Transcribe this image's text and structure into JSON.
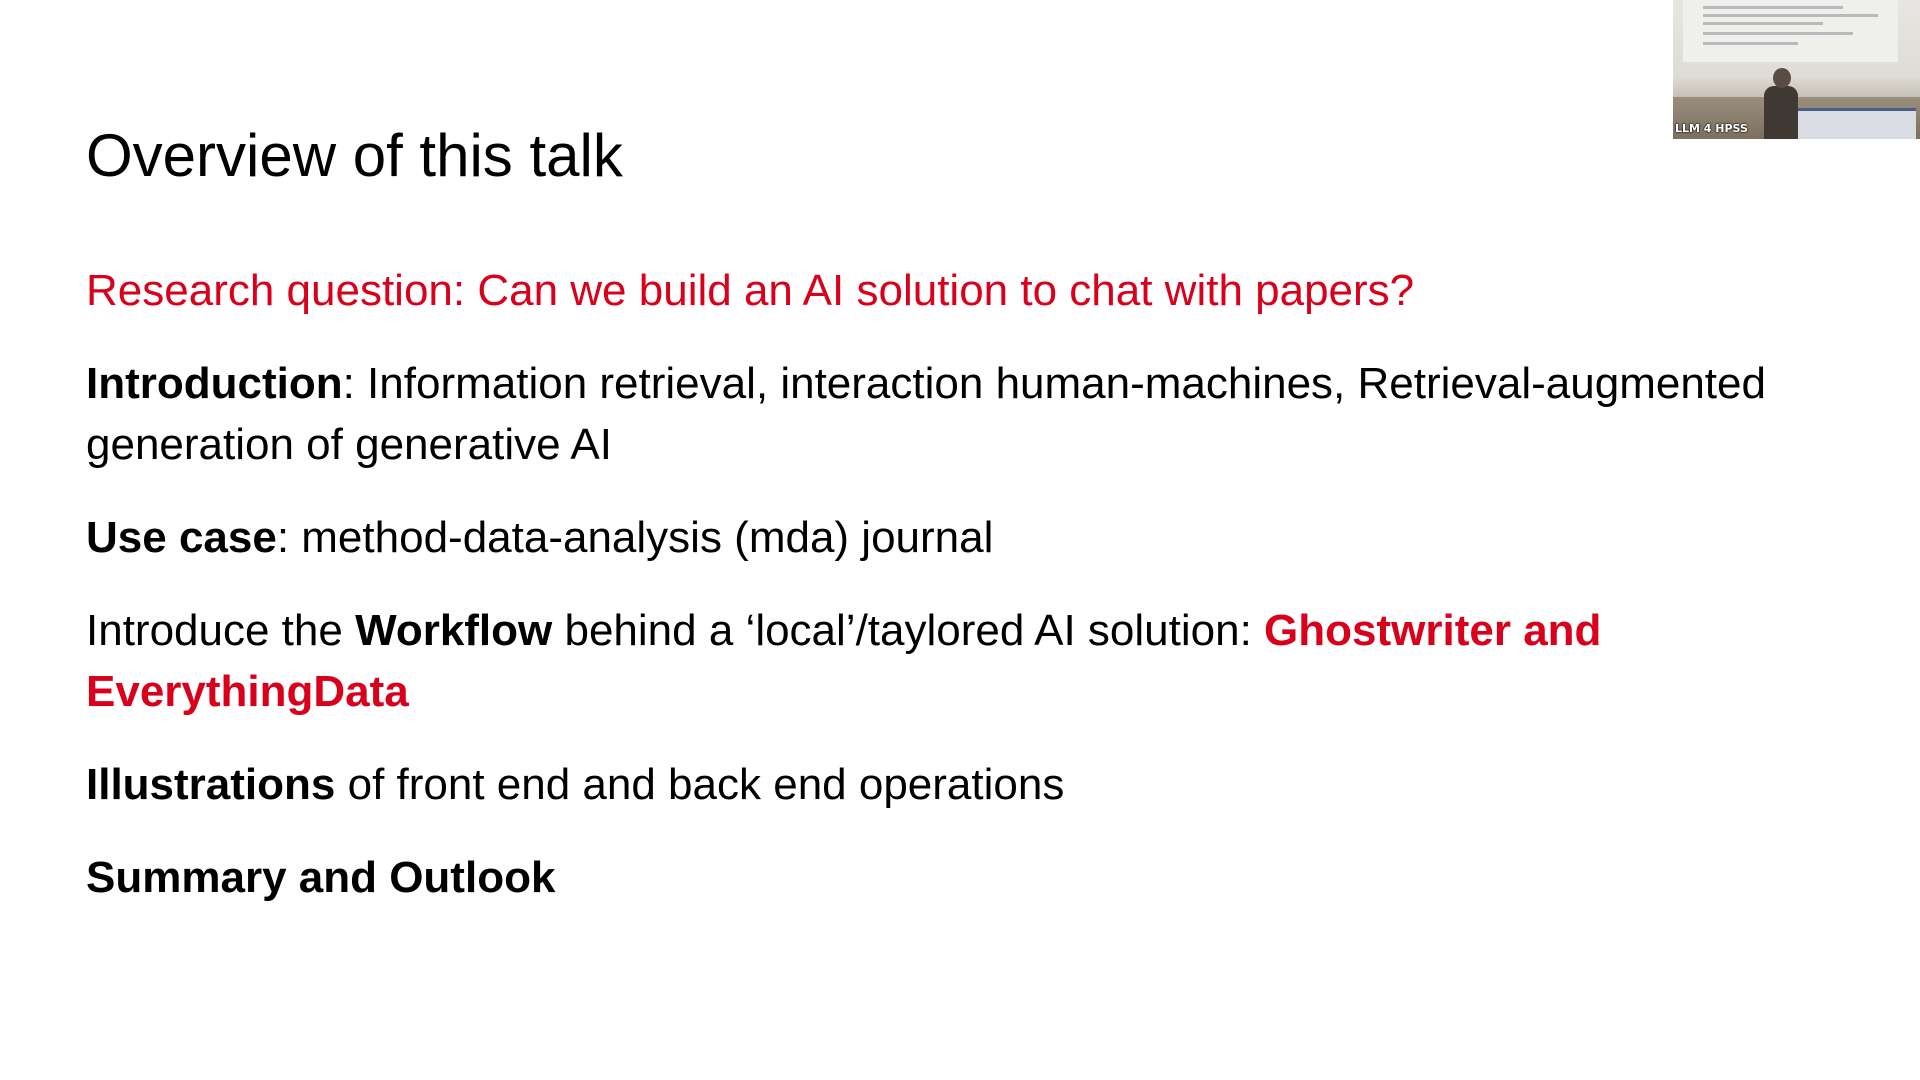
{
  "slide": {
    "title": "Overview of this talk",
    "research_question": "Research question: Can we build an AI solution to chat with papers?",
    "introduction": {
      "term": "Introduction",
      "text": ": Information retrieval, interaction human-machines, Retrieval-augmented generation of generative AI"
    },
    "use_case": {
      "term": "Use case",
      "text": ": method-data-analysis (mda) journal"
    },
    "workflow": {
      "prefix": "Introduce the ",
      "term": "Workflow",
      "middle": " behind a ‘local’/taylored AI solution: ",
      "highlight": "Ghostwriter and EverythingData"
    },
    "illustrations": {
      "term": "Illustrations",
      "text": " of front end and back end operations"
    },
    "summary": "Summary and Outlook"
  },
  "video_overlay": {
    "label": "LLM 4 HPSS"
  },
  "colors": {
    "accent_red": "#d9001b",
    "text": "#000000",
    "background": "#ffffff"
  }
}
